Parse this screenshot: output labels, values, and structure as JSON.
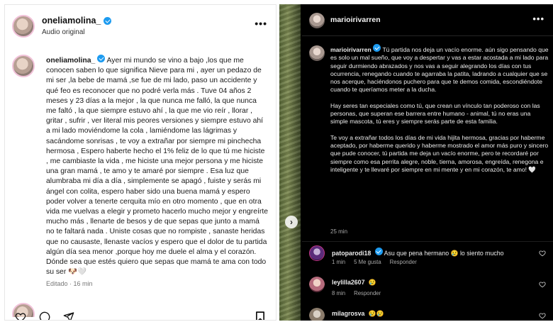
{
  "left_post": {
    "username": "oneliamolina_",
    "subtitle": "Audio original",
    "caption_username": "oneliamolina_",
    "caption_text": "Ayer mi mundo se vino a bajo ,los que me conocen saben lo que significa Nieve para mi , ayer un pedazo de mi ser ,la bebe de mamá ,se fue de mi lado, paso un accidente y qué feo es reconocer que no podré verla más . Tuve 04 años 2 meses y 23 días a la mejor , la que nunca me falló, la que nunca me faltó , la que siempre estuvo ahí , la que me vio reír , llorar , gritar , sufrir , ver literal mis peores versiones y siempre estuvo ahí a mi lado moviéndome la cola , lamiéndome las lágrimas y sacándome sonrisas , te voy a extrañar por siempre mi pinchecha hermosa , Espero haberte hecho el 1% feliz de lo que tú me hiciste , me cambiaste la vida , me hiciste una mejor persona y me hiciste una gran mamá , te amo y te amaré por siempre . Esa luz que alumbraba mi día a día , simplemente se apagó , fuiste y serás mi ángel con colita, espero haber sido una buena mamá y espero poder volver a tenerte cerquita mío en otro momento , que en otra vida me vuelvas a elegir y prometo hacerlo mucho mejor y engreírte mucho más , llenarte de besos y de que sepas que junto a mamá no te faltará nada . Uniste cosas que no rompiste , sanaste heridas que no causaste, llenaste vacíos y espero que el dolor de tu partida algún día sea menor ,porque hoy me duele el alma y el corazón. Dónde sea que estés quiero que sepas que mamá te ama con todo su ser 🐶🤍",
    "meta": "Editado · 16 min",
    "more_icon": "more-horizontal-icon",
    "actions": [
      "heart-icon",
      "comment-icon",
      "share-icon",
      "bookmark-icon"
    ]
  },
  "right_post": {
    "username": "marioirivarren",
    "caption_username": "marioirivarren",
    "paragraphs": [
      "Tú partida nos deja un vacío enorme. aún sigo pensando que es solo un mal sueño, que voy a despertar y vas a estar acostada a mi lado para seguir durmiendo abrazados y nos vas a seguir alegrando los días con tus ocurrencia, renegando cuando te agarraba la patita, ladrando a cualquier que se nos acerque, haciéndonos puchero para que te demos comida, escondiéndote cuando te queríamos meter a la ducha.",
      "Hay seres tan especiales como tú, que crean un vínculo tan poderoso con las personas, que superan ese barrera entre humano - animal, tú no eras una simple mascota, tú eres y siempre serás parte de esta familia.",
      "Te voy a extrañar todos los días de mi vida hijita hermosa, gracias por haberme aceptado, por haberme querido y haberme mostrado el amor más puro y sincero que pude conocer, tú partida me deja un vacío enorme, pero te recordaré por siempre como esa perrita alegre, noble, tierna, amorosa, engreída, renegona e inteligente y te llevaré por siempre en mi mente y en mi corazón, te amo! 🤍"
    ],
    "time": "25 min",
    "nav_arrow": "›",
    "comments": [
      {
        "user": "patoparodi18",
        "text": "Asu que pena hermano 😢 lo siento mucho",
        "time": "1 min",
        "likes": "5 Me gusta",
        "reply": "Responder"
      },
      {
        "user": "leylilla2607",
        "text": "😢",
        "time": "8 min",
        "likes": "",
        "reply": "Responder"
      },
      {
        "user": "milagrosva",
        "text": "😢😢",
        "time": "",
        "likes": "",
        "reply": ""
      }
    ]
  },
  "colors": {
    "verified": "#1d9bf0",
    "dark_bg": "#000000",
    "light_bg": "#ffffff"
  }
}
